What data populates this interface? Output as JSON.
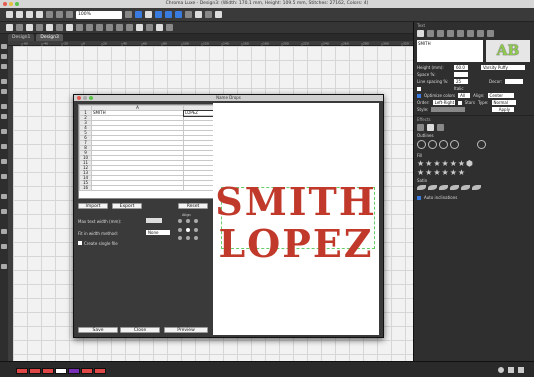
{
  "window": {
    "title": "Chroma Luxe - Design3: (Width: 170.1 mm, Height: 109.5 mm, Stitches: 27162, Colors: 4)"
  },
  "toolbar": {
    "zoom_value": "100%"
  },
  "tabs": [
    {
      "label": "Design1"
    },
    {
      "label": "Design3"
    }
  ],
  "ruler_ticks": [
    "-60",
    "-40",
    "-20",
    "0",
    "20",
    "40",
    "60",
    "80",
    "100",
    "120",
    "140",
    "160",
    "180",
    "200",
    "220",
    "240",
    "260",
    "280",
    "300",
    "320"
  ],
  "sidebar": {
    "panel_title": "Text",
    "font_name": "SMITH",
    "font_family_value": "Varsity Puffy",
    "height_label": "Height (mm):",
    "height_value": "60.0",
    "space_label": "Space %:",
    "space_value": "",
    "line_spacing_label": "Line spacing %:",
    "line_spacing_value": "25",
    "decor_label": "Decor:",
    "italic_label": "Italic",
    "optimize_label": "Optimize colors",
    "optimize_value": "All",
    "align_label": "Align:",
    "align_value": "Center",
    "order_label": "Order:",
    "order_value": "Left-Right",
    "stars_label": "Stars",
    "type_label": "Type:",
    "type_value": "Normal",
    "style_label": "Style:",
    "apply_label": "Apply",
    "effects_title": "Effects",
    "outlines_label": "Outlines",
    "fill_label": "Fill",
    "satin_label": "Satin",
    "auto_inclinations_label": "Auto inclinations"
  },
  "dialog": {
    "title": "Name Drops",
    "columns": [
      "A",
      "B"
    ],
    "rows": [
      {
        "n": "1",
        "a": "SMITH",
        "b": "LOPEZ"
      },
      {
        "n": "2",
        "a": "",
        "b": ""
      },
      {
        "n": "3",
        "a": "",
        "b": ""
      },
      {
        "n": "4",
        "a": "",
        "b": ""
      },
      {
        "n": "5",
        "a": "",
        "b": ""
      },
      {
        "n": "6",
        "a": "",
        "b": ""
      },
      {
        "n": "7",
        "a": "",
        "b": ""
      },
      {
        "n": "8",
        "a": "",
        "b": ""
      },
      {
        "n": "9",
        "a": "",
        "b": ""
      },
      {
        "n": "10",
        "a": "",
        "b": ""
      },
      {
        "n": "11",
        "a": "",
        "b": ""
      },
      {
        "n": "12",
        "a": "",
        "b": ""
      },
      {
        "n": "13",
        "a": "",
        "b": ""
      },
      {
        "n": "14",
        "a": "",
        "b": ""
      },
      {
        "n": "15",
        "a": "",
        "b": ""
      },
      {
        "n": "16",
        "a": "",
        "b": ""
      }
    ],
    "import_label": "Import",
    "export_label": "Export",
    "reset_label": "Reset",
    "max_text_width_label": "Max text width (mm):",
    "align_label": "Align",
    "fit_label": "Fit in width method:",
    "fit_value": "None",
    "create_single_label": "Create single file",
    "save_label": "Save",
    "close_label": "Close",
    "preview_label": "Preview",
    "preview_line1": "SMITH",
    "preview_line2": "LOPEZ"
  },
  "colors": {
    "accent": "#c0392b",
    "swatches": [
      "#e04848",
      "#e04848",
      "#e04848",
      "#ffffff",
      "#7a2fb8",
      "#e04848",
      "#e04848"
    ]
  }
}
